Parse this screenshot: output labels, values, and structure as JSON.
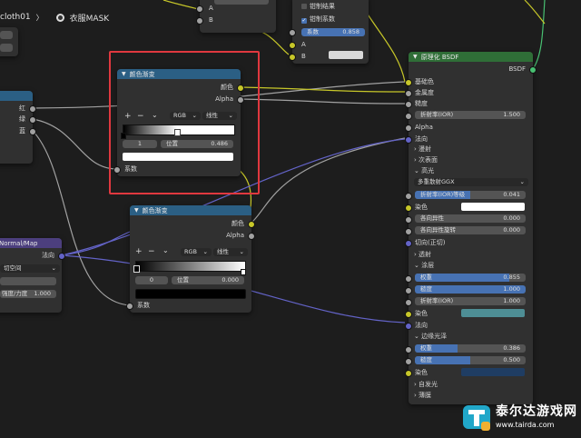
{
  "topbar": {
    "crumb_left": "cloth01",
    "crumb_sep": "〉",
    "material": "衣服MASK"
  },
  "node_top_small": {
    "socket_a": "A",
    "socket_b": "B"
  },
  "node_top_right": {
    "clamp_result": "钳制结果",
    "clamp_factor": "钳制系数",
    "factor_label": "系数",
    "factor_value": "0.858",
    "socket_a": "A",
    "socket_b": "B"
  },
  "node_sepcolor": {
    "out_r": "红",
    "out_g": "绿",
    "out_b": "蓝"
  },
  "color_ramp_1": {
    "title": "颜色渐变",
    "out_color": "颜色",
    "out_alpha": "Alpha",
    "btn_add": "+",
    "btn_remove": "−",
    "btn_menu": "⌄",
    "mode": "RGB",
    "interp": "线性",
    "stop_index": "1",
    "pos_label": "位置",
    "pos_value": "0.486",
    "in_fac": "系数"
  },
  "color_ramp_2": {
    "title": "颜色渐变",
    "out_color": "颜色",
    "out_alpha": "Alpha",
    "btn_add": "+",
    "btn_remove": "−",
    "btn_menu": "⌄",
    "mode": "RGB",
    "interp": "线性",
    "stop_index": "0",
    "pos_label": "位置",
    "pos_value": "0.000",
    "in_fac": "系数"
  },
  "normal_map": {
    "title": "Normal/Map",
    "out_normal": "法向",
    "space": "切空间",
    "strength_label": "强度/力度",
    "strength_value": "1.000"
  },
  "bsdf": {
    "title": "原理化 BSDF",
    "out": "BSDF",
    "base_color": "基础色",
    "metallic": "金属度",
    "roughness": "糙度",
    "ior_label": "折射率(IOR)",
    "ior_value": "1.500",
    "alpha": "Alpha",
    "normal": "法向",
    "sec_subsurface": "次表面",
    "sec_diffuse": "漫射",
    "sec_specular": "高光",
    "distribution": "多重散射GGX",
    "ior_level_label": "折射率(IOR)等级",
    "ior_level_value": "0.041",
    "tint": "染色",
    "aniso_label": "各向异性",
    "aniso_value": "0.000",
    "aniso_rot_label": "各向异性旋转",
    "aniso_rot_value": "0.000",
    "tangent": "切向(正切)",
    "sec_transmission": "透射",
    "sec_coat": "涂层",
    "weight_label": "权重",
    "coat_weight": "0.855",
    "rough_label": "糙度",
    "coat_rough": "1.000",
    "coat_ior_label": "折射率(IOR)",
    "coat_ior": "1.000",
    "coat_tint": "染色",
    "coat_normal": "法向",
    "sec_sheen": "边缘光泽",
    "sheen_weight": "0.386",
    "sheen_rough": "0.500",
    "sheen_tint": "染色",
    "sec_emission": "自发光",
    "sec_thin_film": "薄膜"
  },
  "watermark": {
    "name": "泰尔达游戏网",
    "url": "www.tairda.com"
  },
  "colors": {
    "socket_color": "#c7c729",
    "socket_float": "#a1a1a1",
    "socket_vector": "#6363c7",
    "accent": "#4772b3",
    "highlight": "#e0383f"
  }
}
